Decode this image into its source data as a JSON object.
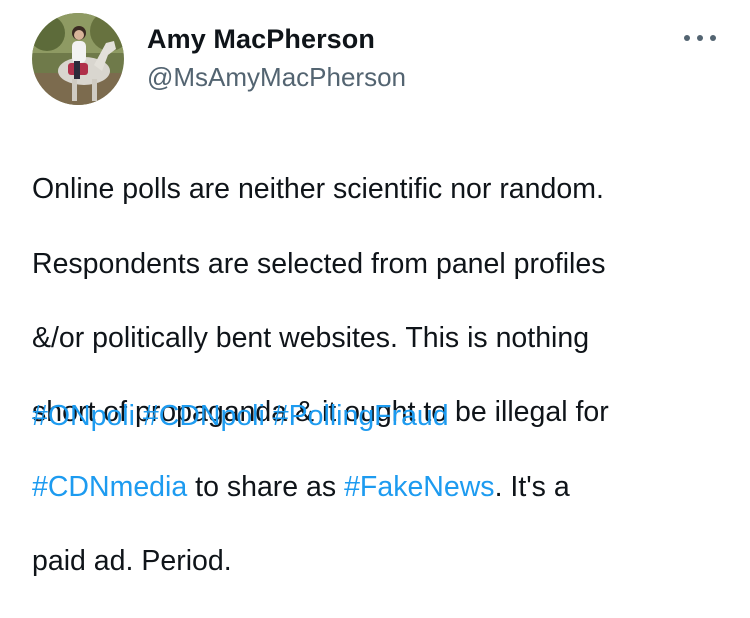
{
  "author": {
    "display_name": "Amy MacPherson",
    "handle": "@MsAmyMacPherson",
    "avatar_icon": "profile-photo-horse-rider"
  },
  "menu": {
    "icon": "more-horizontal-icon"
  },
  "tweet": {
    "line1": "Online polls are neither scientific nor random.",
    "line2": "Respondents are selected from panel profiles",
    "line3": "&/or politically bent websites. This is nothing",
    "line4": "short of propaganda & it ought to be illegal for",
    "hashtag_cdnmedia": "#CDNmedia",
    "line5_mid": " to share as ",
    "hashtag_fakenews": "#FakeNews",
    "line5_end": ". It's a",
    "line6": "paid ad. Period.",
    "hashtags": [
      "#ONpoli",
      "#CDNpoli",
      "#PollingFraud"
    ]
  },
  "colors": {
    "link": "#1d9bf0",
    "secondary_text": "#536471",
    "primary_text": "#0f1419"
  }
}
